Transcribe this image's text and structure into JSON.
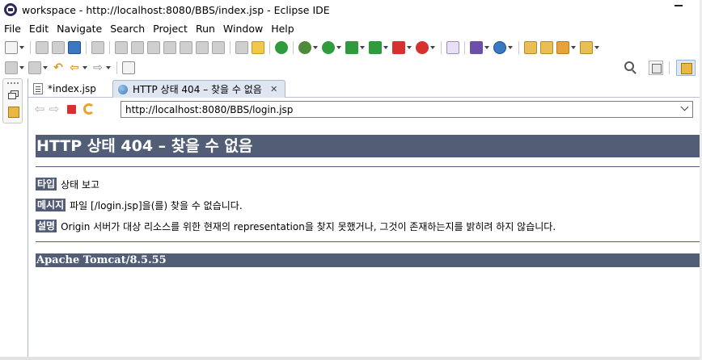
{
  "window": {
    "title": "workspace - http://localhost:8080/BBS/index.jsp - Eclipse IDE"
  },
  "menu": [
    "File",
    "Edit",
    "Navigate",
    "Search",
    "Project",
    "Run",
    "Window",
    "Help"
  ],
  "tabs": [
    {
      "label": "*index.jsp",
      "icon": "jsp-file-icon",
      "active": false
    },
    {
      "label": "HTTP 상태 404 – 찾을 수 없음",
      "icon": "globe-icon",
      "active": true
    }
  ],
  "browser": {
    "url": "http://localhost:8080/BBS/login.jsp"
  },
  "error_page": {
    "heading": "HTTP 상태 404 – 찾을 수 없음",
    "type_label": "타입",
    "type_value": "상태 보고",
    "message_label": "메시지",
    "message_value": "파일 [/login.jsp]을(를) 찾을 수 없습니다.",
    "description_label": "설명",
    "description_value": "Origin 서버가 대상 리소스를 위한 현재의 representation을 찾지 못했거나, 그것이 존재하는지를 밝히려 하지 않습니다.",
    "footer": "Apache Tomcat/8.5.55"
  },
  "colors": {
    "tomcat_header_bg": "#525d76",
    "active_tab_bg": "#dde6f1",
    "stop_red": "#d8302f",
    "run_green": "#2e9b3c"
  }
}
